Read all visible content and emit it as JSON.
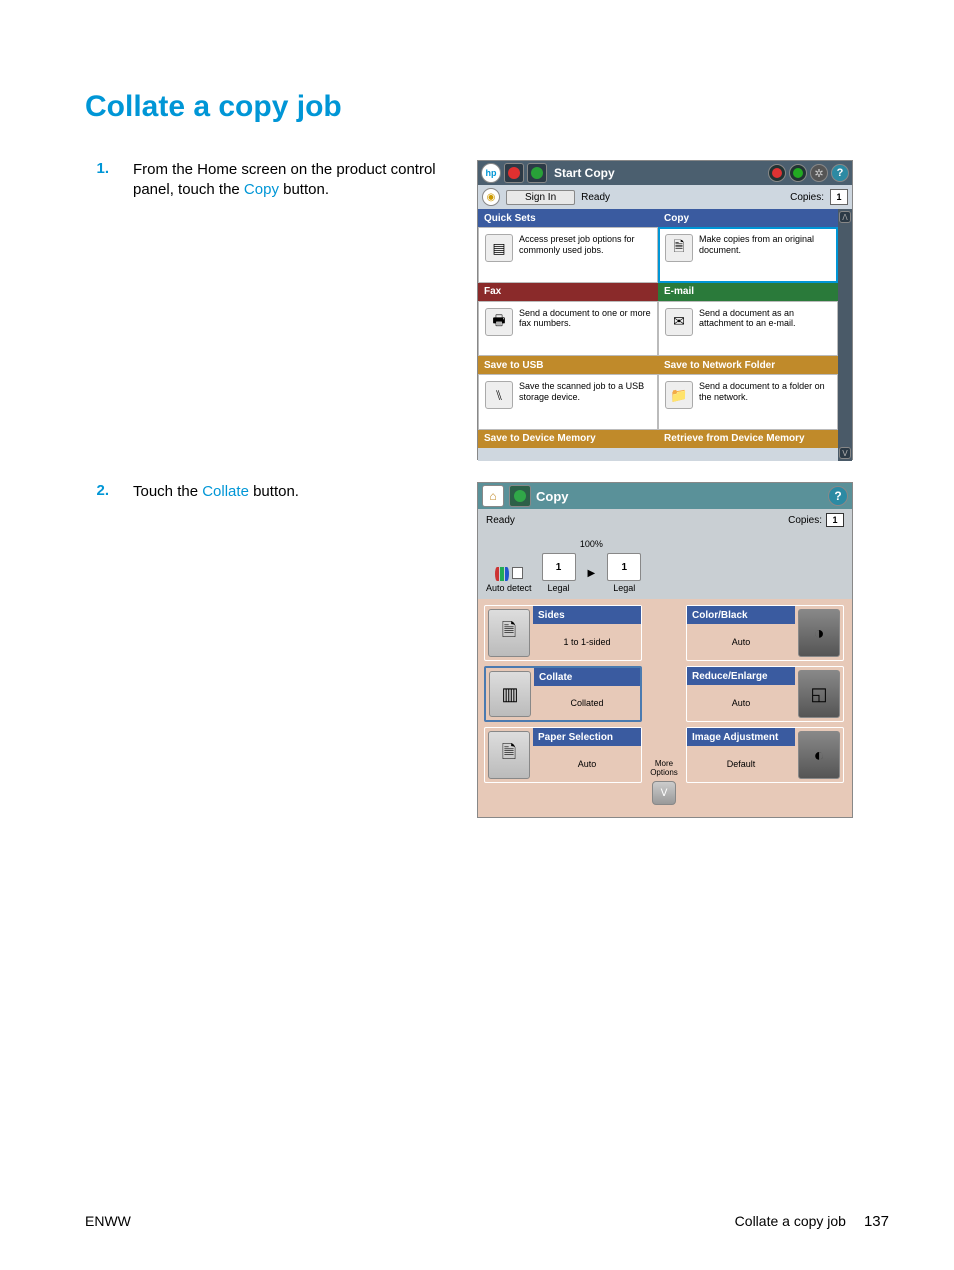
{
  "title": "Collate a copy job",
  "steps": {
    "s1": {
      "num": "1.",
      "pre": "From the Home screen on the product control panel, touch the ",
      "link": "Copy",
      "post": " button."
    },
    "s2": {
      "num": "2.",
      "pre": "Touch the ",
      "link": "Collate",
      "post": " button."
    }
  },
  "screenshot1": {
    "start_copy": "Start Copy",
    "sign_in": "Sign In",
    "ready": "Ready",
    "copies_label": "Copies:",
    "copies_value": "1",
    "tiles": {
      "quick_sets": {
        "hdr": "Quick Sets",
        "desc": "Access preset job options for commonly used jobs."
      },
      "copy": {
        "hdr": "Copy",
        "desc": "Make copies from an original document."
      },
      "fax": {
        "hdr": "Fax",
        "desc": "Send a document to one or more fax numbers."
      },
      "email": {
        "hdr": "E-mail",
        "desc": "Send a document as an attachment to an e-mail."
      },
      "usb": {
        "hdr": "Save to USB",
        "desc": "Save the scanned job to a USB storage device."
      },
      "network": {
        "hdr": "Save to Network Folder",
        "desc": "Send a document to a folder on the network."
      },
      "save_mem": {
        "hdr": "Save to Device Memory"
      },
      "retr_mem": {
        "hdr": "Retrieve from Device Memory"
      }
    }
  },
  "screenshot2": {
    "title": "Copy",
    "ready": "Ready",
    "copies_label": "Copies:",
    "copies_value": "1",
    "percent": "100%",
    "page_in": "1",
    "page_out": "1",
    "legal_in": "Legal",
    "legal_out": "Legal",
    "auto_detect": "Auto detect",
    "more_options": "More Options",
    "options": {
      "sides": {
        "hdr": "Sides",
        "val": "1 to 1-sided"
      },
      "collate": {
        "hdr": "Collate",
        "val": "Collated"
      },
      "paper": {
        "hdr": "Paper Selection",
        "val": "Auto"
      },
      "color": {
        "hdr": "Color/Black",
        "val": "Auto"
      },
      "reduce": {
        "hdr": "Reduce/Enlarge",
        "val": "Auto"
      },
      "image": {
        "hdr": "Image Adjustment",
        "val": "Default"
      }
    }
  },
  "footer": {
    "left": "ENWW",
    "title": "Collate a copy job",
    "page": "137"
  }
}
